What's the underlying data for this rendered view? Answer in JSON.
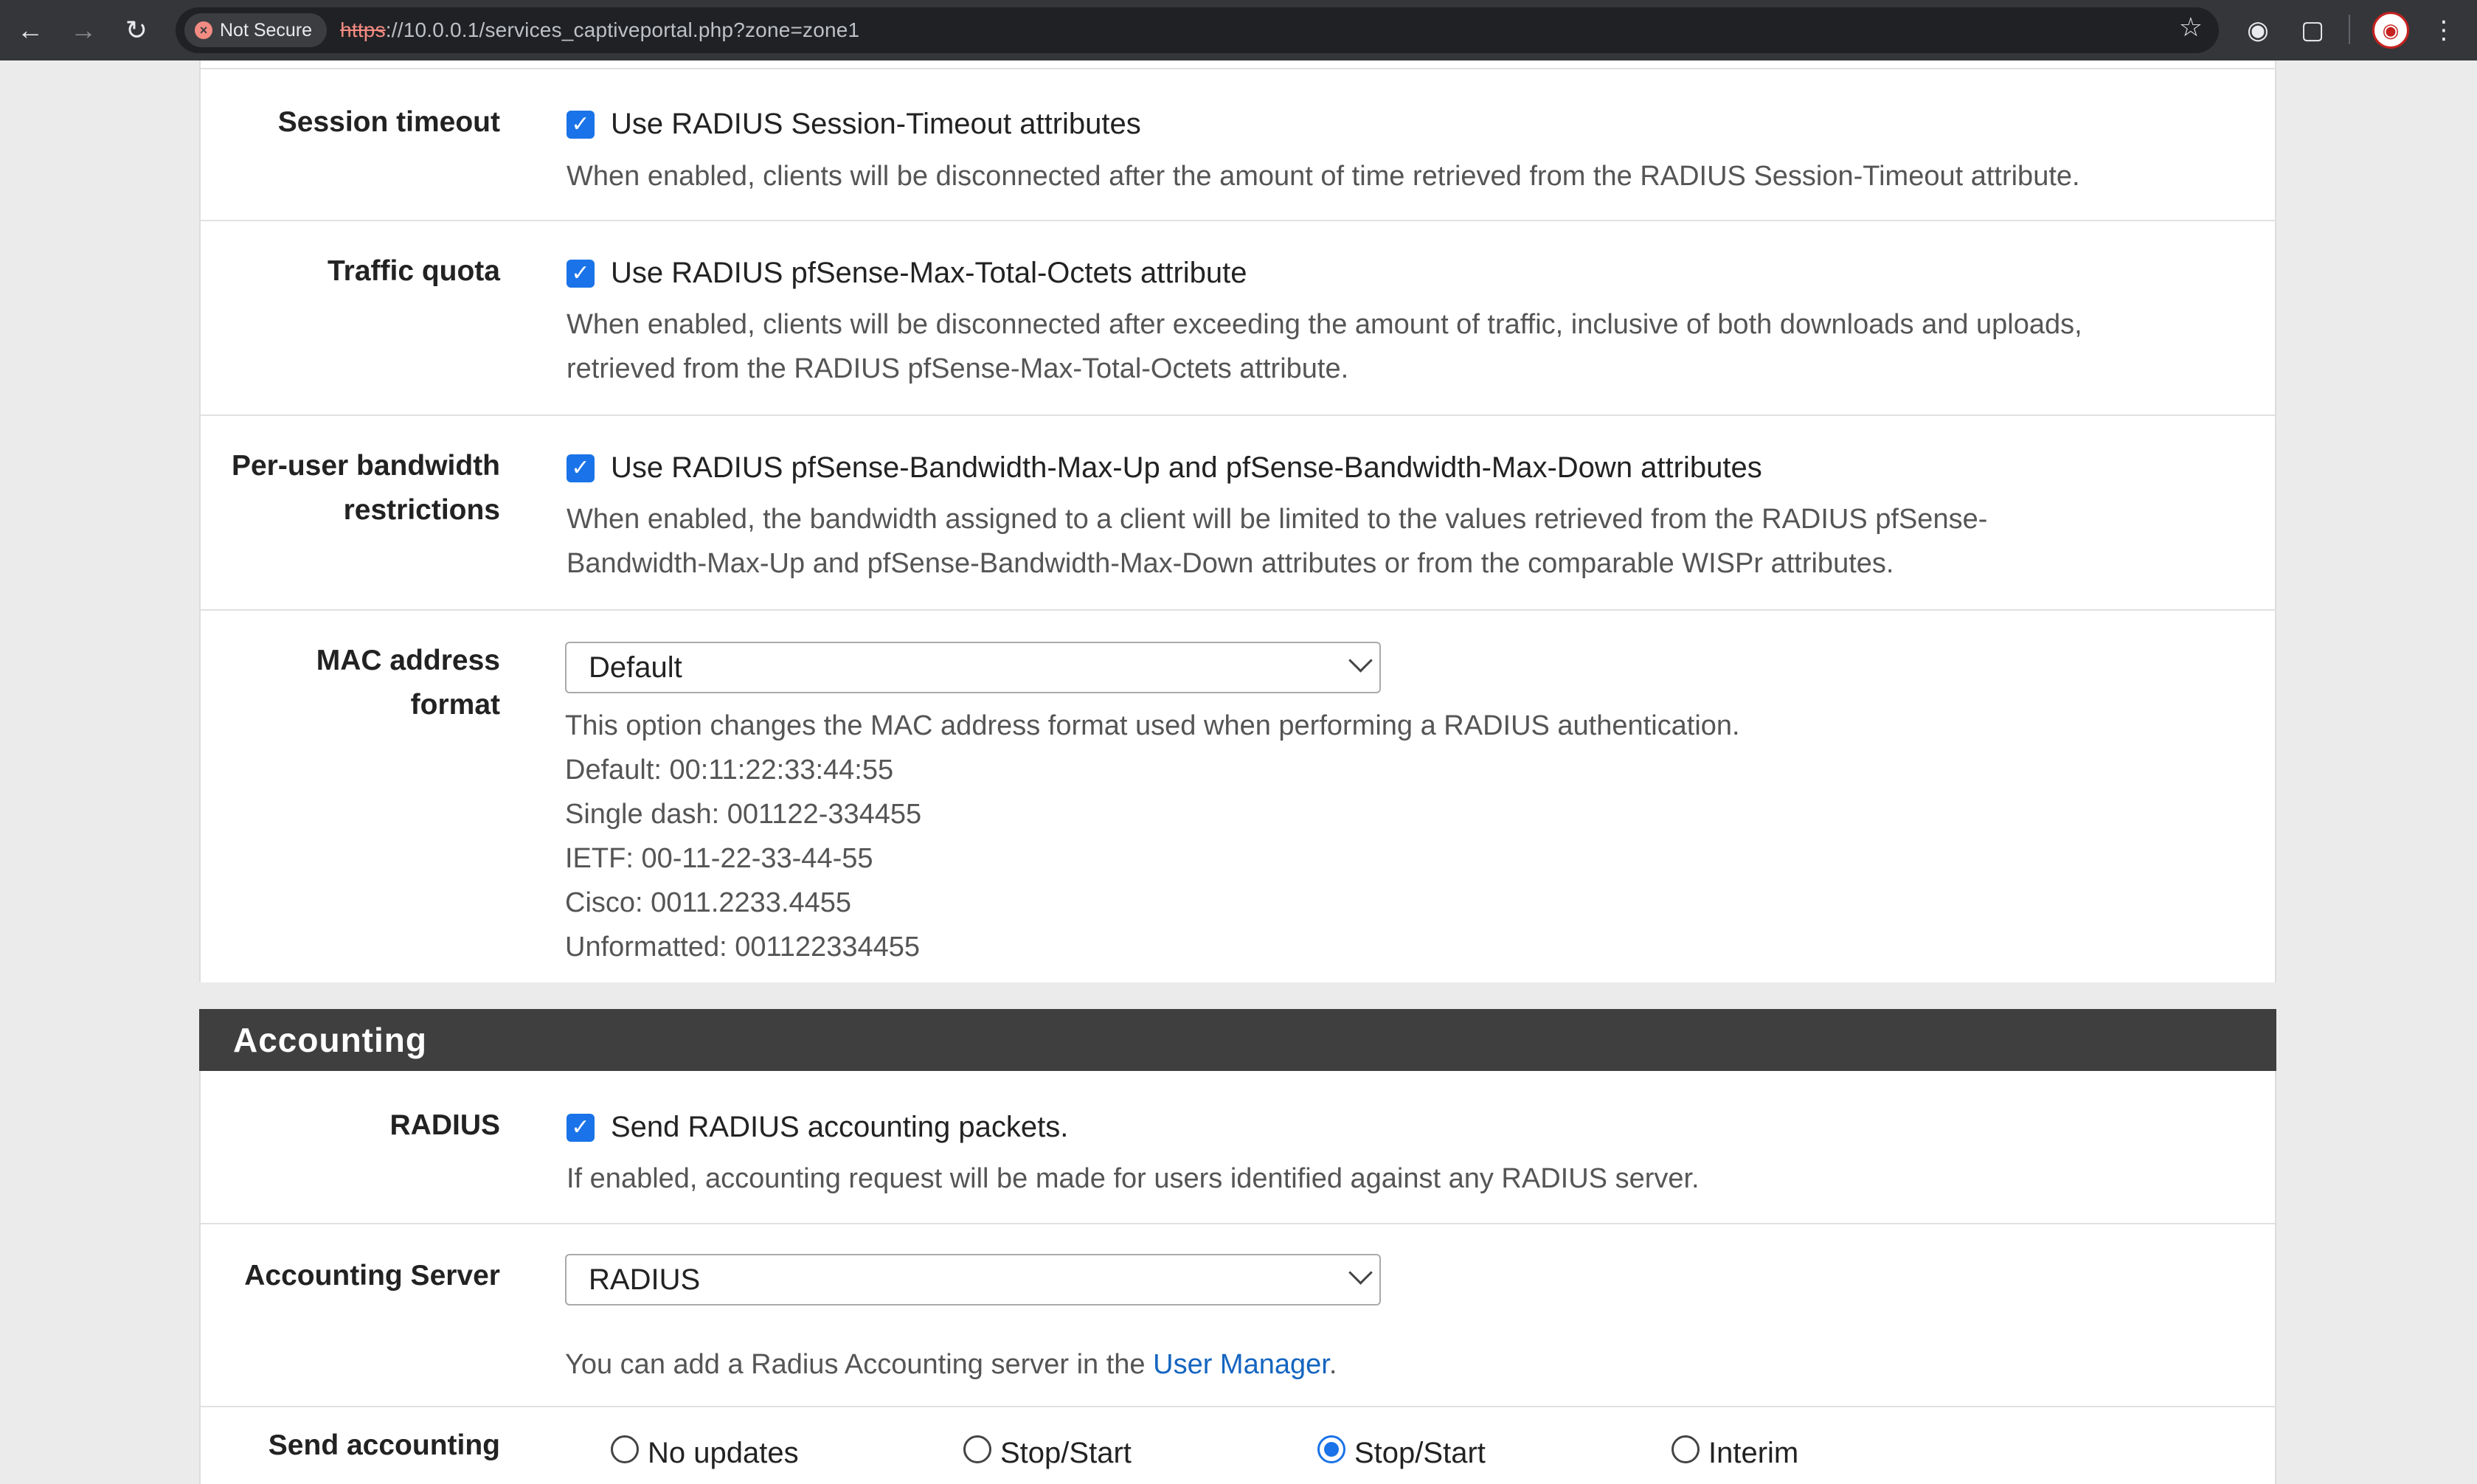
{
  "browser": {
    "security_label": "Not Secure",
    "url_scheme": "https",
    "url_rest": "://10.0.0.1/services_captiveportal.php?zone=zone1"
  },
  "authentication": {
    "session_timeout": {
      "label": "Session timeout",
      "checkbox_label": "Use RADIUS Session-Timeout attributes",
      "checked": true,
      "help": "When enabled, clients will be disconnected after the amount of time retrieved from the RADIUS Session-Timeout attribute."
    },
    "traffic_quota": {
      "label": "Traffic quota",
      "checkbox_label": "Use RADIUS pfSense-Max-Total-Octets attribute",
      "checked": true,
      "help_line1": "When enabled, clients will be disconnected after exceeding the amount of traffic, inclusive of both downloads and uploads,",
      "help_line2": "retrieved from the RADIUS pfSense-Max-Total-Octets attribute."
    },
    "bandwidth": {
      "label_line1": "Per-user bandwidth",
      "label_line2": "restrictions",
      "checkbox_label": "Use RADIUS pfSense-Bandwidth-Max-Up and pfSense-Bandwidth-Max-Down attributes",
      "checked": true,
      "help_line1": "When enabled, the bandwidth assigned to a client will be limited to the values retrieved from the RADIUS pfSense-",
      "help_line2": "Bandwidth-Max-Up and pfSense-Bandwidth-Max-Down attributes or from the comparable WISPr attributes."
    },
    "mac_format": {
      "label_line1": "MAC address",
      "label_line2": "format",
      "selected": "Default",
      "help_lines": [
        "This option changes the MAC address format used when performing a RADIUS authentication.",
        "Default: 00:11:22:33:44:55",
        "Single dash: 001122-334455",
        "IETF: 00-11-22-33-44-55",
        "Cisco: 0011.2233.4455",
        "Unformatted: 001122334455"
      ]
    }
  },
  "accounting": {
    "section_title": "Accounting",
    "radius": {
      "label": "RADIUS",
      "checkbox_label": "Send RADIUS accounting packets.",
      "checked": true,
      "help": "If enabled, accounting request will be made for users identified against any RADIUS server."
    },
    "server": {
      "label": "Accounting Server",
      "selected": "RADIUS",
      "help_prefix": "You can add a Radius Accounting server in the ",
      "help_link": "User Manager",
      "help_suffix": "."
    },
    "send_accounting": {
      "label": "Send accounting",
      "options": [
        {
          "label": "No updates",
          "selected": false
        },
        {
          "label": "Stop/Start",
          "selected": false
        },
        {
          "label": "Stop/Start",
          "selected": true
        },
        {
          "label": "Interim",
          "selected": false
        }
      ]
    }
  },
  "colors": {
    "checkbox": "#1a73e8",
    "section_header": "#3f3f3f",
    "link": "#1565c0"
  }
}
